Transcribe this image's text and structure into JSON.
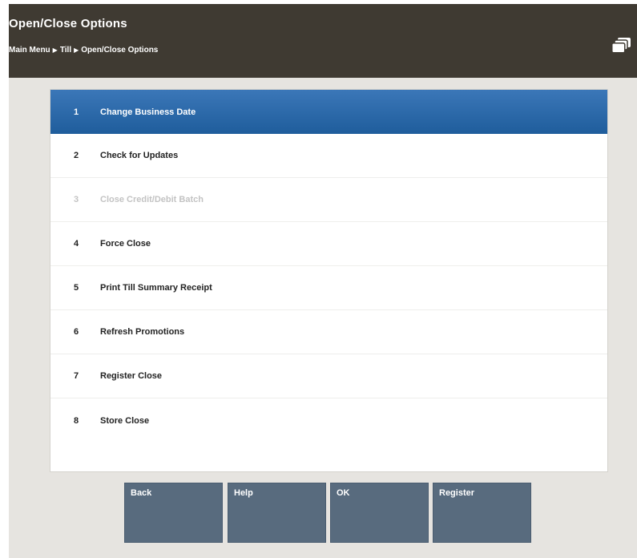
{
  "header": {
    "title": "Open/Close Options",
    "breadcrumb": [
      "Main Menu",
      "Till",
      "Open/Close Options"
    ],
    "session_icon": "stacked-windows-icon"
  },
  "menu": {
    "items": [
      {
        "number": "1",
        "label": "Change Business Date",
        "state": "selected"
      },
      {
        "number": "2",
        "label": "Check for Updates",
        "state": "enabled"
      },
      {
        "number": "3",
        "label": "Close Credit/Debit Batch",
        "state": "disabled"
      },
      {
        "number": "4",
        "label": "Force Close",
        "state": "enabled"
      },
      {
        "number": "5",
        "label": "Print Till Summary Receipt",
        "state": "enabled"
      },
      {
        "number": "6",
        "label": "Refresh Promotions",
        "state": "enabled"
      },
      {
        "number": "7",
        "label": "Register Close",
        "state": "enabled"
      },
      {
        "number": "8",
        "label": "Store Close",
        "state": "enabled"
      }
    ]
  },
  "buttons": {
    "back": "Back",
    "help": "Help",
    "ok": "OK",
    "register": "Register"
  },
  "colors": {
    "header_bg": "#3f3a32",
    "selected_bg": "#2a68a8",
    "button_bg": "#586b7e",
    "stage_bg": "#e6e4e0"
  }
}
